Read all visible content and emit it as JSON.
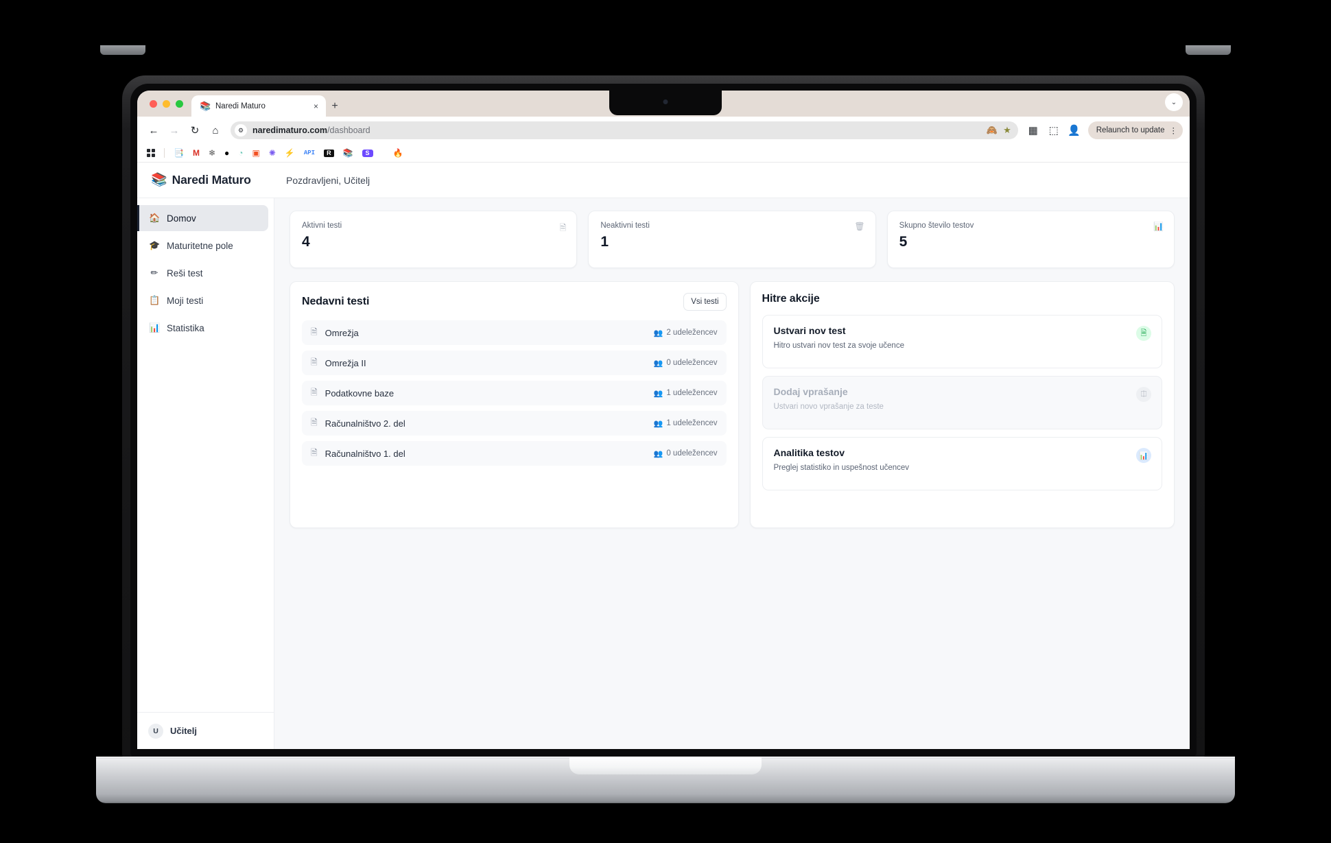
{
  "browser": {
    "traffic_lights": [
      "close",
      "minimize",
      "maximize"
    ],
    "tab": {
      "favicon": "books-icon",
      "title": "Naredi Maturo",
      "close_label": "×"
    },
    "new_tab_label": "+",
    "chevron_label": "⌄",
    "nav": {
      "back": "←",
      "forward": "→",
      "reload": "↻",
      "home": "⌂"
    },
    "omnibox": {
      "site_icon": "site-settings-icon",
      "domain": "naredimaturo.com",
      "path": "/dashboard"
    },
    "toolbar_icons": {
      "tracking_protection": "◡",
      "bookmark_star": "★",
      "picture_in_picture": "▣",
      "extensions": "⬚",
      "profile": "🧑"
    },
    "relaunch": {
      "label": "Relaunch to update",
      "menu": "⋮"
    },
    "bookmarks": [
      {
        "name": "apps-grid-icon",
        "glyph": ""
      },
      {
        "name": "google-docs-icon",
        "glyph": "📘"
      },
      {
        "name": "gmail-icon",
        "glyph": "M"
      },
      {
        "name": "openai-icon",
        "glyph": "◌"
      },
      {
        "name": "vercel-icon",
        "glyph": "▲"
      },
      {
        "name": "mint-icon",
        "glyph": "◔"
      },
      {
        "name": "microsoft-icon",
        "glyph": "⊞"
      },
      {
        "name": "chatgpt-icon",
        "glyph": "✻"
      },
      {
        "name": "supabase-icon",
        "glyph": "⚡"
      },
      {
        "name": "api-icon",
        "glyph": "API"
      },
      {
        "name": "r-icon",
        "glyph": "R"
      },
      {
        "name": "naredi-maturo-icon",
        "glyph": "📚"
      },
      {
        "name": "s-icon",
        "glyph": "S"
      },
      {
        "name": "firebase-icon",
        "glyph": "🔥"
      }
    ]
  },
  "app": {
    "brand": {
      "icon": "books-icon",
      "name": "Naredi Maturo"
    },
    "greeting": "Pozdravljeni, Učitelj",
    "sidebar": {
      "items": [
        {
          "icon": "home-icon",
          "glyph": "🏠",
          "label": "Domov",
          "active": true
        },
        {
          "icon": "graduation-cap-icon",
          "glyph": "🎓",
          "label": "Maturitetne pole",
          "active": false
        },
        {
          "icon": "pencil-icon",
          "glyph": "✏",
          "label": "Reši test",
          "active": false
        },
        {
          "icon": "clipboard-icon",
          "glyph": "📋",
          "label": "Moji testi",
          "active": false
        },
        {
          "icon": "bar-chart-icon",
          "glyph": "📊",
          "label": "Statistika",
          "active": false
        }
      ],
      "user": {
        "initial": "U",
        "name": "Učitelj"
      }
    },
    "stats": [
      {
        "label": "Aktivni testi",
        "value": "4",
        "icon": "document-icon",
        "glyph": "🗎"
      },
      {
        "label": "Neaktivni testi",
        "value": "1",
        "icon": "archive-icon",
        "glyph": "🗑"
      },
      {
        "label": "Skupno število testov",
        "value": "5",
        "icon": "bar-chart-icon",
        "glyph": "📊"
      }
    ],
    "recent_tests": {
      "title": "Nedavni testi",
      "all_button": "Vsi testi",
      "items": [
        {
          "icon": "document-icon",
          "name": "Omrežja",
          "participants": "2 udeležencev"
        },
        {
          "icon": "document-icon",
          "name": "Omrežja II",
          "participants": "0 udeležencev"
        },
        {
          "icon": "document-icon",
          "name": "Podatkovne baze",
          "participants": "1 udeležencev"
        },
        {
          "icon": "document-icon",
          "name": "Računalništvo 2. del",
          "participants": "1 udeležencev"
        },
        {
          "icon": "document-icon",
          "name": "Računalništvo 1. del",
          "participants": "0 udeležencev"
        }
      ]
    },
    "quick_actions": {
      "title": "Hitre akcije",
      "items": [
        {
          "title": "Ustvari nov test",
          "desc": "Hitro ustvari nov test za svoje učence",
          "icon": "document-plus-icon",
          "glyph": "🗎",
          "tone": "green",
          "disabled": false
        },
        {
          "title": "Dodaj vprašanje",
          "desc": "Ustvari novo vprašanje za teste",
          "icon": "brain-icon",
          "glyph": "Ⓐ",
          "tone": "grey",
          "disabled": true
        },
        {
          "title": "Analitika testov",
          "desc": "Preglej statistiko in uspešnost učencev",
          "icon": "bar-chart-icon",
          "glyph": "📊",
          "tone": "blue",
          "disabled": false
        }
      ]
    }
  },
  "colors": {
    "accent_dark": "#1c2433",
    "page_bg": "#f7f8fa",
    "card_bg": "#ffffff",
    "border": "#eceef1",
    "green": "#16a34a",
    "blue": "#2563eb"
  }
}
